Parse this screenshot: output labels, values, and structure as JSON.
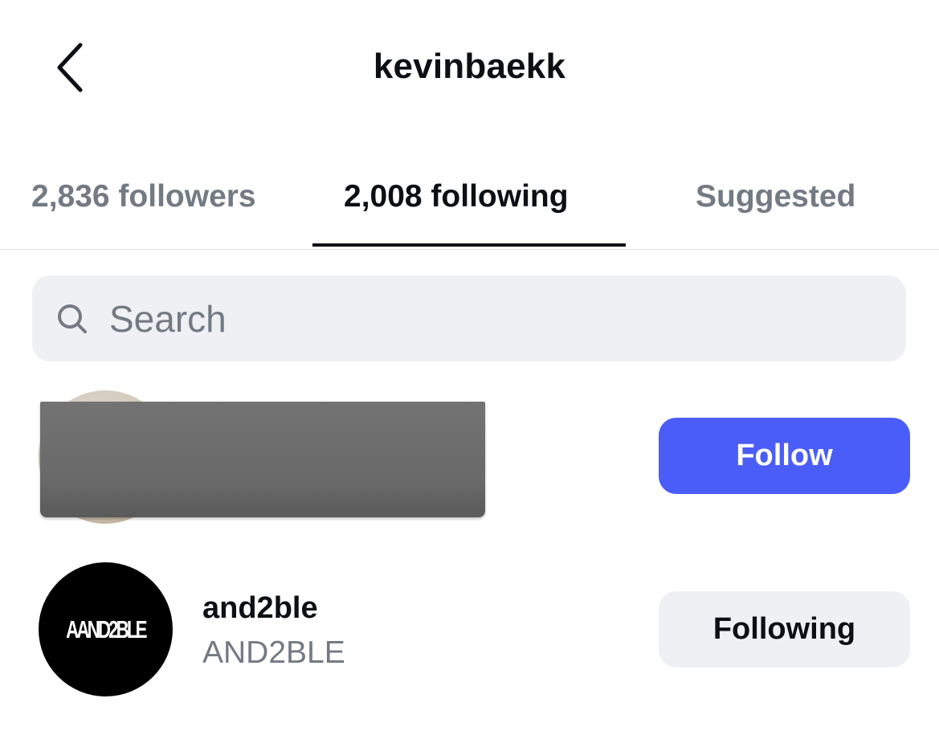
{
  "header": {
    "title": "kevinbaekk",
    "back_icon": "chevron-left-icon"
  },
  "tabs": [
    {
      "label": "2,836 followers",
      "active": false
    },
    {
      "label": "2,008 following",
      "active": true
    },
    {
      "label": "Suggested",
      "active": false
    }
  ],
  "search": {
    "placeholder": "Search",
    "value": "",
    "icon": "search-icon"
  },
  "accounts": [
    {
      "username": "",
      "full_name": "",
      "redacted": true,
      "button_label": "Follow"
    },
    {
      "username": "and2ble",
      "full_name": "AND2BLE",
      "avatar_logo_text": "AAND2BLE",
      "redacted": false,
      "button_label": "Following"
    }
  ],
  "colors": {
    "follow_button": "#4a5df9",
    "following_button": "#eff0f3",
    "muted_text": "#737a84",
    "primary_text": "#0c1014"
  }
}
